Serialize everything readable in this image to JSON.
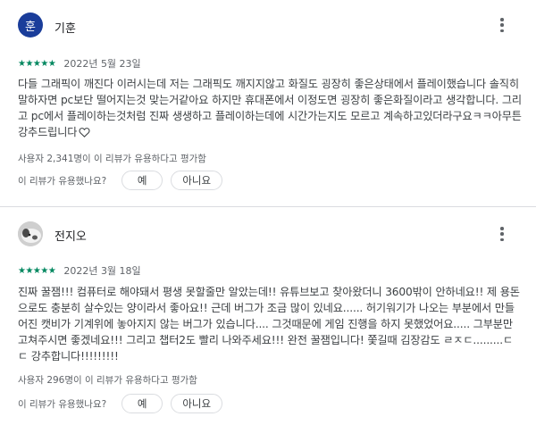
{
  "reviews": [
    {
      "avatar_letter": "훈",
      "avatar_color": "#1a3d9a",
      "name": "기훈",
      "stars": "★★★★★",
      "date": "2022년 5월 23일",
      "body": "다들 그래픽이 깨진다 이러시는데 저는 그래픽도 깨지지않고 화질도 굉장히 좋은상태에서 플레이했습니다 솔직히 말하자면 pc보단 떨어지는것 맞는거같아요 하지만 휴대폰에서 이정도면 굉장히 좋은화질이라고 생각합니다. 그리고 pc에서 플레이하는것처럼 진짜 생생하고 플레이하는데에 시간가는지도 모르고 계속하고있더라구요ㅋㅋ아무튼 강추드립니다",
      "trailing_icon": "heart-outline-icon",
      "helpful_count": "사용자 2,341명이 이 리뷰가 유용하다고 평가함",
      "question": "이 리뷰가 유용했나요?",
      "yes_label": "예",
      "no_label": "아니요"
    },
    {
      "avatar_image": "profile-photo",
      "name": "전지오",
      "stars": "★★★★★",
      "date": "2022년 3월 18일",
      "body": "진짜 꿀잼!!! 컴퓨터로 해야돼서 평생 못할줄만 알았는데!! 유튜브보고 찾아왔더니 3600밖이 안하네요!! 제 용돈으로도 충분히 살수있는 양이라서 좋아요!! 근데 버그가 조금 많이 있네요...... 허기워기가 나오는 부분에서 만들어진 캣비가 기계위에 놓아지지 않는 버그가 있습니다.... 그것때문에 게임 진행을 하지 못했었어요..... 그부분만 고쳐주시면 좋겠네요!!! 그리고 챕터2도 빨리 나와주세요!!! 완전 꿀잼입니다! 쫓길때 김장감도 ㄹㅈㄷ.........ㄷㄷ 강추합니다!!!!!!!!!",
      "helpful_count": "사용자 296명이 이 리뷰가 유용하다고 평가함",
      "question": "이 리뷰가 유용했나요?",
      "yes_label": "예",
      "no_label": "아니요"
    }
  ],
  "icons": {
    "more": "more-vert-icon",
    "star": "star-icon"
  },
  "colors": {
    "star_green": "#01875f",
    "secondary_text": "#5f6368",
    "divider": "#dadce0"
  }
}
